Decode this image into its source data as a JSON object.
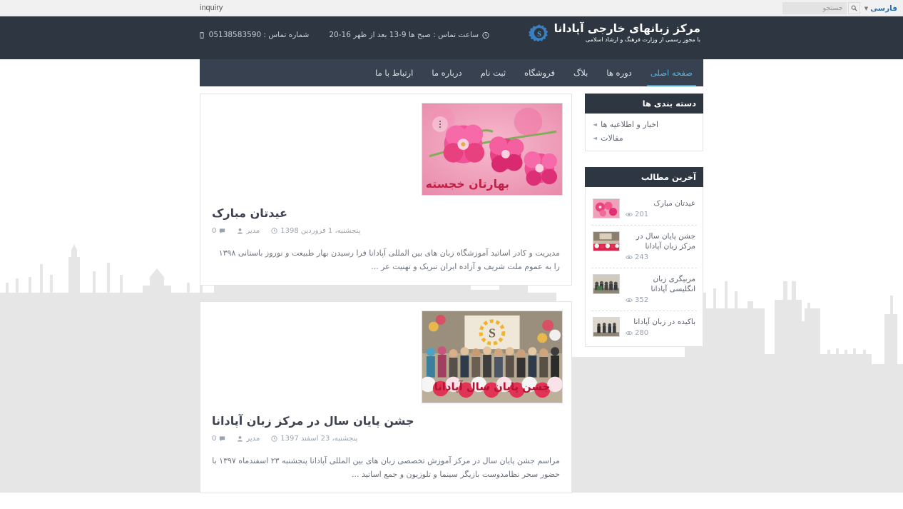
{
  "browser": {
    "tab_text": "inquiry",
    "language_label": "فارسی",
    "search_placeholder": "جستجو",
    "search_icon": "search-icon",
    "caret_icon": "chevron-down-icon"
  },
  "header": {
    "logo_title": "مرکز زبانهای خارجی آپادانا",
    "logo_subtitle": "با مجوز رسمی از وزارت فرهنگ و ارشاد اسلامی",
    "logo_icon": "gear-logo-icon",
    "contacts": [
      {
        "icon": "clock-icon",
        "text": "ساعت تماس : صبح ها 9-13 بعد از ظهر 16-20"
      },
      {
        "icon": "mobile-icon",
        "text": "شماره تماس : 05138583590"
      }
    ]
  },
  "nav": {
    "items": [
      {
        "label": "صفحه اصلی",
        "active": true
      },
      {
        "label": "دوره ها",
        "active": false
      },
      {
        "label": "بلاگ",
        "active": false
      },
      {
        "label": "فروشگاه",
        "active": false
      },
      {
        "label": "ثبت نام",
        "active": false
      },
      {
        "label": "درباره ما",
        "active": false
      },
      {
        "label": "ارتباط با ما",
        "active": false
      }
    ],
    "active_color": "#5bb6e0",
    "underline_color": "#39a4d8"
  },
  "sidebar": {
    "categories_widget": {
      "title": "دسته بندی ها",
      "items": [
        {
          "label": "اخبار و اطلاعیه ها"
        },
        {
          "label": "مقالات"
        }
      ]
    },
    "latest_widget": {
      "title": "آخرین مطالب",
      "items": [
        {
          "title": "عیدتان مبارک",
          "views": "201",
          "thumb": "flowers-thumb"
        },
        {
          "title": "جشن پایان سال در مرکز زبان آپادانا",
          "views": "243",
          "thumb": "party-thumb"
        },
        {
          "title": "مربیگری زبان انگلیسی آپادانا",
          "views": "352",
          "thumb": "group-thumb"
        },
        {
          "title": "باکیده در زبان آپادانا",
          "views": "280",
          "thumb": "people-thumb"
        }
      ],
      "views_icon": "eye-icon"
    }
  },
  "posts": [
    {
      "title": "عیدتان مبارک",
      "date": "پنجشنبه، 1 فروردین 1398",
      "author": "مدیر",
      "comments": "0",
      "excerpt": "مدیریت و کادر اساتید آموزشگاه زبان های بین المللی آپادانا فرا رسیدن بهار طبیعت و نوروز باستانی ۱۳۹۸ را به عموم ملت شریف و آزاده ایران تبریک و تهنیت عر ...",
      "image": "cherry-blossom",
      "image_caption": "بهارتان خجسته",
      "date_icon": "clock-icon",
      "author_icon": "user-icon",
      "comment_icon": "comment-icon"
    },
    {
      "title": "جشن پایان سال در مرکز زبان آپادانا",
      "date": "پنجشنبه، 23 اسفند 1397",
      "author": "مدیر",
      "comments": "0",
      "excerpt": "مراسم جشن پایان سال در مرکز آموزش تخصصی زبان های بین المللی آپادانا پنجشنبه ۲۳ اسفندماه ۱۳۹۷ با حضور سحر نظامدوست بازیگر سینما و تلوزیون و جمع اساتید ...",
      "image": "year-end-party",
      "image_caption": "جشن پایان سال آپادانا",
      "date_icon": "clock-icon",
      "author_icon": "user-icon",
      "comment_icon": "comment-icon"
    }
  ],
  "theme": {
    "header_bg": "#2e3642",
    "nav_bg": "#384150",
    "accent": "#39a4d8",
    "page_bg": "#ffffff",
    "skyline_color": "#e6e6e6",
    "text_muted": "#9aa2ad"
  }
}
